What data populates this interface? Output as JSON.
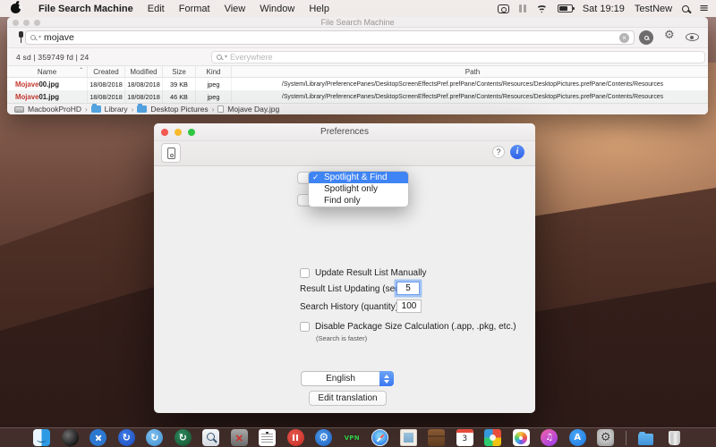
{
  "menu_bar": {
    "app_name": "File Search Machine",
    "items": [
      "Edit",
      "Format",
      "View",
      "Window",
      "Help"
    ],
    "time": "Sat 19:19",
    "user": "TestNew"
  },
  "main_window": {
    "title": "File Search Machine",
    "search_value": "mojave",
    "clear_label": "×",
    "stats": "4 sd  |  359749 fd  |  24",
    "scope_placeholder": "Everywhere",
    "columns": {
      "name": "Name",
      "created": "Created",
      "modified": "Modified",
      "size": "Size",
      "kind": "Kind",
      "path": "Path"
    },
    "sort_indicator": "ˆ",
    "rows": [
      {
        "name_main": "Mojave",
        "name_suffix": " 00.jpg",
        "created": "18/08/2018",
        "modified": "18/08/2018",
        "size": "39 KB",
        "kind": "jpeg",
        "path": "/System/Library/PreferencePanes/DesktopScreenEffectsPref.prefPane/Contents/Resources/DesktopPictures.prefPane/Contents/Resources"
      },
      {
        "name_main": "Mojave",
        "name_suffix": " 01.jpg",
        "created": "18/08/2018",
        "modified": "18/08/2018",
        "size": "46 KB",
        "kind": "jpeg",
        "path": "/System/Library/PreferencePanes/DesktopScreenEffectsPref.prefPane/Contents/Resources/DesktopPictures.prefPane/Contents/Resources"
      }
    ],
    "breadcrumb": {
      "disk": "MacbookProHD",
      "sep": "›",
      "folder1": "Library",
      "folder2": "Desktop Pictures",
      "file": "Mojave Day.jpg"
    }
  },
  "preferences": {
    "title": "Preferences",
    "help_label": "?",
    "info_label": "i",
    "dropdown": {
      "checkmark": "✓",
      "items": [
        "Spotlight & Find",
        "Spotlight only",
        "Find only"
      ],
      "selected": "Spotlight & Find"
    },
    "update_manually_label": "Update Result List Manually",
    "result_list_label": "Result List Updating (sec.)",
    "result_list_value": "5",
    "search_history_label": "Search History (quantity)",
    "search_history_value": "100",
    "disable_package_label": "Disable Package Size Calculation (.app, .pkg, etc.)",
    "disable_package_note": "(Search is faster)",
    "language_value": "English",
    "edit_translation_label": "Edit translation"
  },
  "dock": {
    "calendar_day": "3",
    "vpn_label": "VPN",
    "sync_glyph": "↻",
    "gear_glyph": "⚙",
    "music_glyph": "♫",
    "appstore_glyph": "A",
    "trashx_glyph": "×",
    "icons": [
      "finder",
      "bird",
      "tools",
      "sync-blue",
      "sync-light",
      "sync-green",
      "search-app",
      "trash-x",
      "textedit",
      "pause",
      "gear-wrench",
      "vpn",
      "safari",
      "mail-stamp",
      "wallet",
      "calendar",
      "collage",
      "photos",
      "music",
      "app-store",
      "system-preferences",
      "downloads-folder",
      "trash"
    ]
  },
  "colors": {
    "accent_blue": "#3f84f4",
    "highlight_red": "#c3362e",
    "dock_bg": "#58423e"
  }
}
